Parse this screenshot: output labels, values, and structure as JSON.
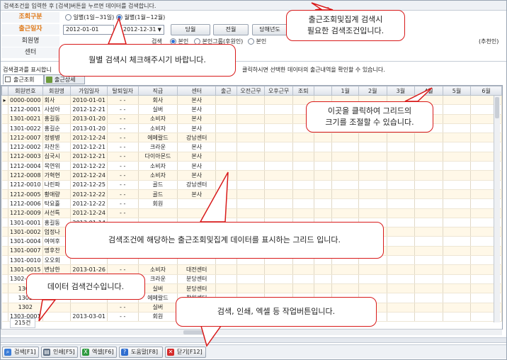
{
  "top_hint": "검색조건을 입력한 후 [검색]버튼을 누르면 데이터를 검색합니다.",
  "filters": {
    "search_type_label": "조회구분",
    "radio_daily": "일별(1일~31일)",
    "radio_monthly": "월별(1월~12월)",
    "date_label": "출근일자",
    "date_from": "2012-01-01",
    "date_to": "2012-12-31",
    "btn_today": "당월",
    "btn_prev": "전월",
    "btn_year": "당해년도",
    "member_label": "회원명",
    "search_label": "검색",
    "radio_self": "본인",
    "radio_self_group": "본인그룹(후원인)",
    "radio_self_all": "본인",
    "radio_recommend_tail": "(추천인)",
    "center_label": "센터"
  },
  "grid_hint_left": "검색결과를 표시합니",
  "grid_hint_right": "클릭하시면 선택한 데이터의 출근내역을 확인할 수 있습니다.",
  "tabs": [
    "출근조회",
    "출근상세"
  ],
  "columns": [
    "회원번호",
    "회원명",
    "가입일자",
    "탈퇴일자",
    "직급",
    "센터",
    "출근",
    "오전근무",
    "오후근무",
    "조퇴",
    "",
    "1월",
    "2월",
    "3월",
    "4월",
    "5월",
    "6월"
  ],
  "rows": [
    [
      "0000-0000",
      "회사",
      "2010-01-01",
      "- -",
      "회사",
      "본사"
    ],
    [
      "1212-0001",
      "사성아",
      "2012-12-21",
      "- -",
      "실버",
      "본사"
    ],
    [
      "1301-0021",
      "홍길동",
      "2013-01-20",
      "- -",
      "소비자",
      "본사"
    ],
    [
      "1301-0022",
      "홍길순",
      "2013-01-20",
      "- -",
      "소비자",
      "본사"
    ],
    [
      "1212-0007",
      "정병병",
      "2012-12-24",
      "- -",
      "에메랄드",
      "강남센터"
    ],
    [
      "1212-0002",
      "차찬돈",
      "2012-12-21",
      "- -",
      "크라운",
      "본사"
    ],
    [
      "1212-0003",
      "심국시",
      "2012-12-21",
      "- -",
      "다이아몬드",
      "본사"
    ],
    [
      "1212-0004",
      "목연위",
      "2012-12-22",
      "- -",
      "소비자",
      "본사"
    ],
    [
      "1212-0008",
      "가혁현",
      "2012-12-24",
      "- -",
      "소비자",
      "본사"
    ],
    [
      "1212-0010",
      "나린파",
      "2012-12-25",
      "- -",
      "골드",
      "강남센터"
    ],
    [
      "1212-0005",
      "황애량",
      "2012-12-22",
      "- -",
      "골드",
      "본사"
    ],
    [
      "1212-0006",
      "탁요흘",
      "2012-12-22",
      "- -",
      "회원",
      ""
    ],
    [
      "1212-0009",
      "서선특",
      "2012-12-24",
      "- -",
      "",
      ""
    ],
    [
      "1301-0001",
      "홍길동",
      "2013-01-14",
      "- -",
      "",
      ""
    ],
    [
      "1301-0002",
      "엄정나",
      "",
      "",
      "",
      ""
    ],
    [
      "1301-0004",
      "여여후",
      "",
      "",
      "",
      ""
    ],
    [
      "1301-0007",
      "명후찬",
      "",
      "",
      "",
      ""
    ],
    [
      "1301-0010",
      "오오회",
      "",
      "",
      "",
      ""
    ],
    [
      "1301-0015",
      "변남한",
      "2013-01-26",
      "- -",
      "소비자",
      "대전센터"
    ],
    [
      "1302-0001",
      "",
      "",
      "- -",
      "크라운",
      "분당센터"
    ],
    [
      "1302",
      "",
      "",
      "- -",
      "실버",
      "분당센터"
    ],
    [
      "1302",
      "",
      "",
      "- -",
      "에메랄드",
      "창원센터"
    ],
    [
      "1302",
      "",
      "",
      "- -",
      "실버",
      "본사"
    ],
    [
      "1303-0001",
      "",
      "2013-03-01",
      "- -",
      "회원",
      "본사"
    ]
  ],
  "row_count": "215건",
  "bottom_buttons": [
    {
      "label": "검색[F1]",
      "icon": "search-icon",
      "color": "#3b7dd8"
    },
    {
      "label": "인쇄[F5]",
      "icon": "print-icon",
      "color": "#5a6b80"
    },
    {
      "label": "엑셀[F6]",
      "icon": "excel-icon",
      "color": "#2e9a3f"
    },
    {
      "label": "도움말[F8]",
      "icon": "help-icon",
      "color": "#2f6ed0"
    },
    {
      "label": "닫기[F12]",
      "icon": "close-icon",
      "color": "#d42a2a"
    }
  ],
  "callouts": {
    "condition": "출근조회및집계 검색시\n필요한 검색조건입니다.",
    "monthly": "월별 검색시 체크해주시기 바랍니다.",
    "resize": "이곳을 클릭하여 그리드의\n크기를 조절할 수 있습니다.",
    "grid": "검색조건에 해당하는 출근조회및집계 데이터를 표시하는 그리드 입니다.",
    "count": "데이터 검색건수입니다.",
    "buttons": "검색, 인쇄, 엑셀 등 작업버튼입니다."
  }
}
